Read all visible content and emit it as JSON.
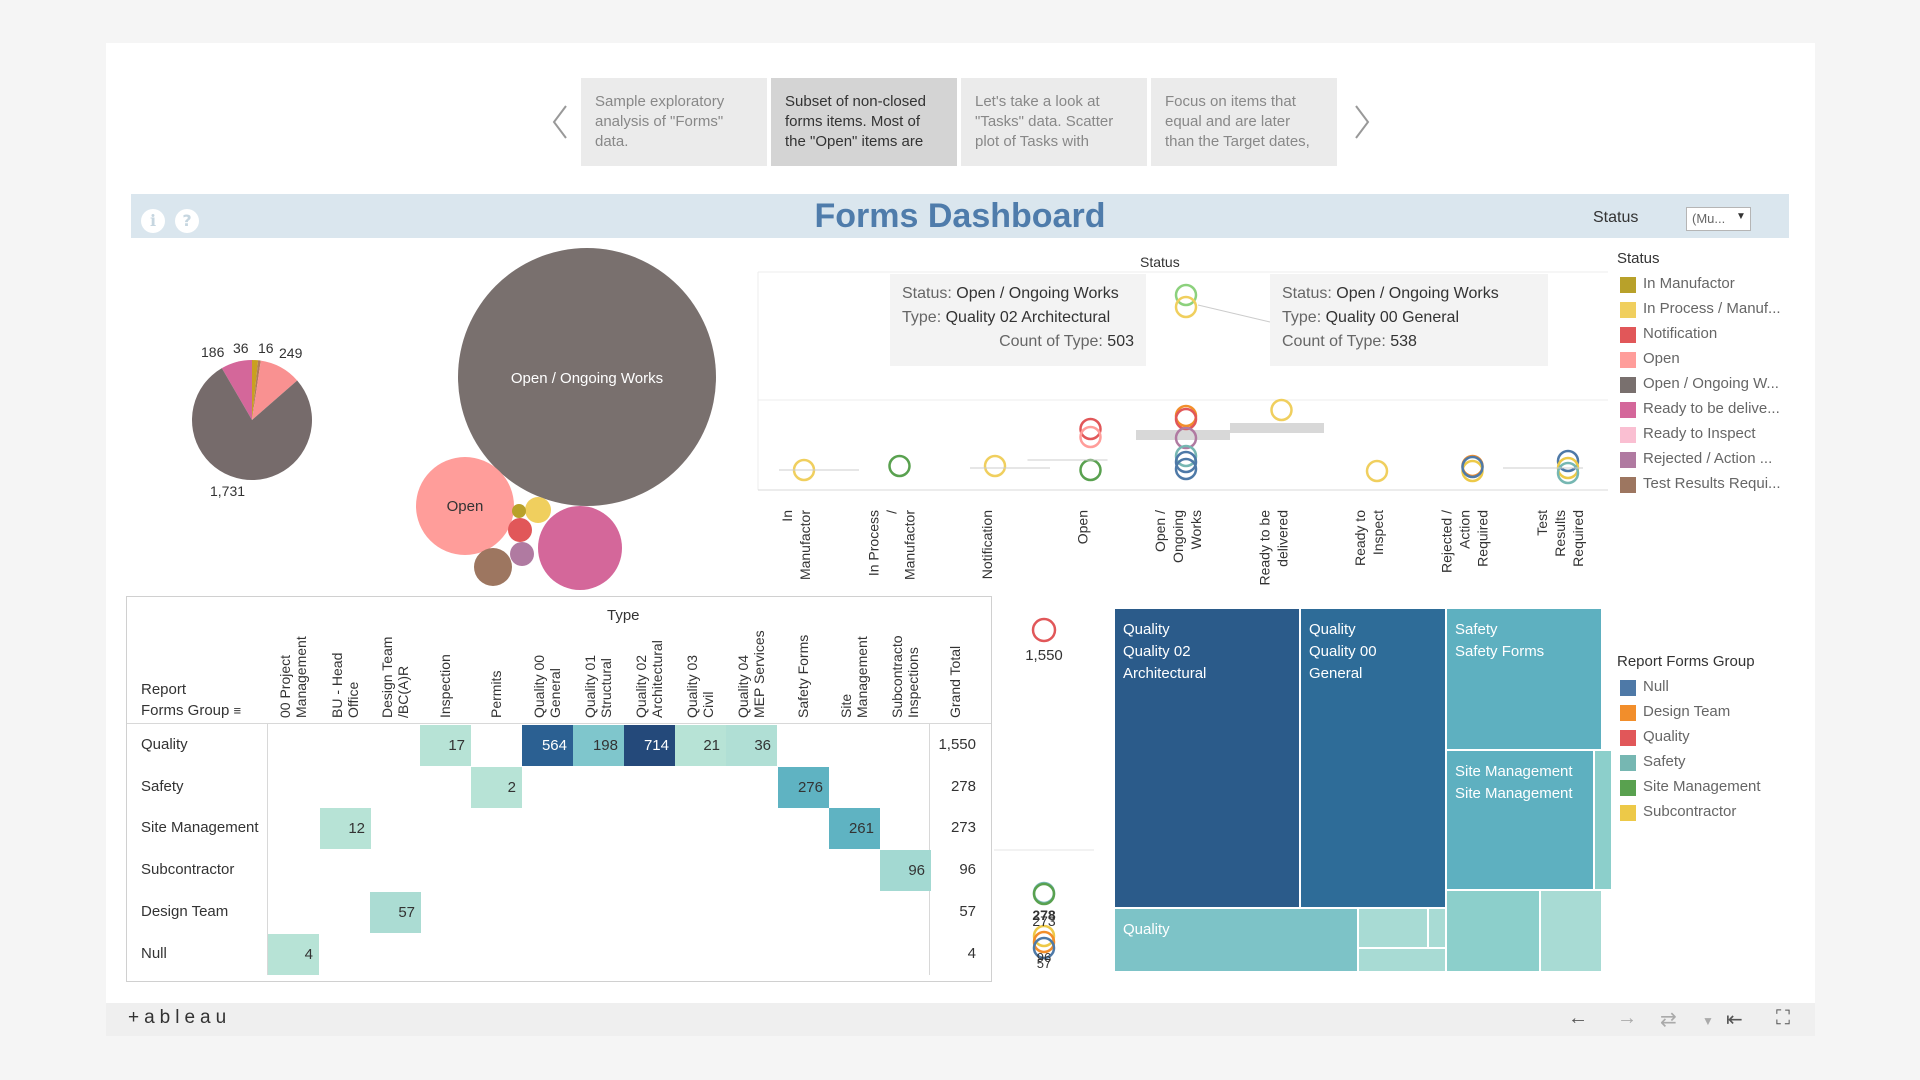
{
  "story": {
    "points": [
      "Sample exploratory analysis of \"Forms\" data.",
      "Subset of non-closed forms items. Most of the \"Open\" items are",
      "Let's take a look at \"Tasks\" data. Scatter plot of Tasks with",
      "Focus on items that equal and are later than the Target dates,"
    ],
    "active_index": 1
  },
  "dashboard": {
    "title": "Forms Dashboard",
    "status_filter_label": "Status",
    "status_filter_value": "(Mu...",
    "info_glyph": "i",
    "help_glyph": "?"
  },
  "pie": {
    "labels": [
      "186",
      "36",
      "16",
      "249",
      "1,731"
    ],
    "values": [
      186,
      36,
      16,
      249,
      1731
    ],
    "colors": [
      "#d4679a",
      "#c9a020",
      "#b07a5a",
      "#f99191",
      "#766b6b"
    ]
  },
  "bubbles": {
    "open_ongoing_label": "Open / Ongoing Works",
    "open_label": "Open"
  },
  "status_chart": {
    "title": "Status",
    "categories": [
      "In Manufactor",
      "In Process / Manufactor",
      "Notification",
      "Open",
      "Open / Ongoing Works",
      "Ready to be delivered",
      "Ready to Inspect",
      "Rejected / Action Required",
      "Test Results Required"
    ],
    "tooltip1": {
      "status_label": "Status:",
      "status_value": "Open / Ongoing Works",
      "type_label": "Type:",
      "type_value": "Quality 02 Architectural",
      "count_label": "Count of Type:",
      "count_value": "503"
    },
    "tooltip2": {
      "status_label": "Status:",
      "status_value": "Open / Ongoing Works",
      "type_label": "Type:",
      "type_value": "Quality 00 General",
      "count_label": "Count of Type:",
      "count_value": "538"
    }
  },
  "status_legend": {
    "title": "Status",
    "items": [
      {
        "label": "In Manufactor",
        "color": "#b8a12a"
      },
      {
        "label": "In Process / Manuf...",
        "color": "#f0cf5e"
      },
      {
        "label": "Notification",
        "color": "#e15759"
      },
      {
        "label": "Open",
        "color": "#ff9d9a"
      },
      {
        "label": "Open / Ongoing W...",
        "color": "#79706e"
      },
      {
        "label": "Ready to be delive...",
        "color": "#d4679a"
      },
      {
        "label": "Ready to Inspect",
        "color": "#fabfd2"
      },
      {
        "label": "Rejected / Action ...",
        "color": "#b07aa1"
      },
      {
        "label": "Test Results Requi...",
        "color": "#9d7660"
      }
    ]
  },
  "crosstab": {
    "type_header": "Type",
    "row_header_1": "Report",
    "row_header_2": "Forms Group",
    "columns": [
      "00 Project Management",
      "BU - Head Office",
      "Design Team /BC(A)R",
      "Inspection",
      "Permits",
      "Quality 00 General",
      "Quality 01 Structural",
      "Quality 02 Architectural",
      "Quality 03 Civil",
      "Quality 04 MEP Services",
      "Safety Forms",
      "Site Management",
      "Subcontracto Inspections",
      "Grand Total"
    ],
    "rows": [
      {
        "label": "Quality",
        "total": "1,550"
      },
      {
        "label": "Safety",
        "total": "278"
      },
      {
        "label": "Site Management",
        "total": "273"
      },
      {
        "label": "Subcontractor",
        "total": "96"
      },
      {
        "label": "Design Team",
        "total": "57"
      },
      {
        "label": "Null",
        "total": "4"
      }
    ],
    "cells": [
      {
        "row": 0,
        "col": 3,
        "value": "17",
        "color": "#b7e3d6"
      },
      {
        "row": 0,
        "col": 5,
        "value": "564",
        "color": "#2b6092",
        "light": true
      },
      {
        "row": 0,
        "col": 6,
        "value": "198",
        "color": "#7fc6cc"
      },
      {
        "row": 0,
        "col": 7,
        "value": "714",
        "color": "#24497a",
        "light": true
      },
      {
        "row": 0,
        "col": 8,
        "value": "21",
        "color": "#b7e3d6"
      },
      {
        "row": 0,
        "col": 9,
        "value": "36",
        "color": "#b0dfd5"
      },
      {
        "row": 1,
        "col": 4,
        "value": "2",
        "color": "#b7e3d6"
      },
      {
        "row": 1,
        "col": 10,
        "value": "276",
        "color": "#5fb3c2"
      },
      {
        "row": 2,
        "col": 1,
        "value": "12",
        "color": "#b7e3d6"
      },
      {
        "row": 2,
        "col": 11,
        "value": "261",
        "color": "#5fb3c2"
      },
      {
        "row": 3,
        "col": 12,
        "value": "96",
        "color": "#a3d9d2"
      },
      {
        "row": 4,
        "col": 2,
        "value": "57",
        "color": "#abdcd3"
      },
      {
        "row": 5,
        "col": 0,
        "value": "4",
        "color": "#b7e3d6"
      }
    ]
  },
  "dot_plot": {
    "top_label": "1,550",
    "stack_labels": [
      "278",
      "273",
      "96",
      "57"
    ]
  },
  "treemap": {
    "tiles": [
      {
        "lines": [
          "Quality",
          "Quality 02",
          "Architectural"
        ],
        "color": "#2b5b8a"
      },
      {
        "lines": [
          "Quality",
          "Quality 00",
          "General"
        ],
        "color": "#2e6c98"
      },
      {
        "lines": [
          "Safety",
          "Safety Forms"
        ],
        "color": "#5eb0c0"
      },
      {
        "lines": [
          "Site Management",
          "Site Management"
        ],
        "color": "#5eb0c0"
      },
      {
        "lines": [
          "Quality"
        ],
        "color": "#7dc3c7"
      }
    ]
  },
  "report_legend": {
    "title": "Report Forms Group",
    "items": [
      {
        "label": "Null",
        "color": "#4e79a7"
      },
      {
        "label": "Design Team",
        "color": "#f28e2b"
      },
      {
        "label": "Quality",
        "color": "#e15759"
      },
      {
        "label": "Safety",
        "color": "#76b7b2"
      },
      {
        "label": "Site Management",
        "color": "#59a14f"
      },
      {
        "label": "Subcontractor",
        "color": "#edc948"
      }
    ]
  },
  "toolbar": {
    "logo": "+ableau",
    "undo_icon": "←",
    "redo_icon": "→",
    "revert_icon": "⇥",
    "fullscreen_icon": "⛶"
  }
}
